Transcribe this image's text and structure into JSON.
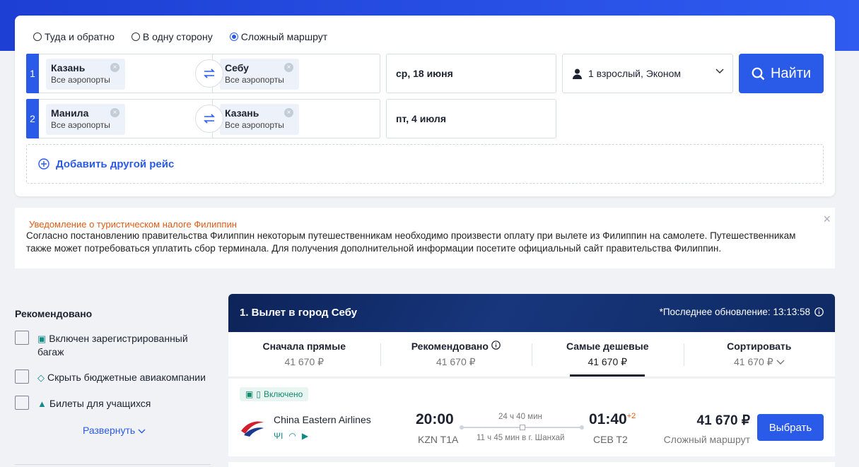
{
  "search": {
    "trip_types": [
      {
        "label": "Туда и обратно",
        "selected": false
      },
      {
        "label": "В одну сторону",
        "selected": false
      },
      {
        "label": "Сложный маршрут",
        "selected": true
      }
    ],
    "legs": [
      {
        "num": "1",
        "from": {
          "city": "Казань",
          "sub": "Все аэропорты"
        },
        "to": {
          "city": "Себу",
          "sub": "Все аэропорты"
        },
        "date": "ср, 18 июня"
      },
      {
        "num": "2",
        "from": {
          "city": "Манила",
          "sub": "Все аэропорты"
        },
        "to": {
          "city": "Казань",
          "sub": "Все аэропорты"
        },
        "date": "пт, 4 июля"
      }
    ],
    "passengers": "1 взрослый, Эконом",
    "find_label": "Найти",
    "add_leg_label": "Добавить другой рейс"
  },
  "notice": {
    "title": "Уведомление о туристическом налоге Филиппин",
    "text": "Согласно постановлению правительства Филиппин некоторым путешественникам необходимо произвести оплату при вылете из Филиппин на самолете. Путешественникам также может потребоваться уплатить сбор терминала. Для получения дополнительной информации посетите официальный сайт правительства Филиппин.",
    "close": "×"
  },
  "filters": {
    "title": "Рекомендовано",
    "items": [
      {
        "label": "Включен зарегистрированный багаж",
        "icon": "luggage-icon"
      },
      {
        "label": "Скрыть бюджетные авиакомпании",
        "icon": "tag-icon"
      },
      {
        "label": "Билеты для учащихся",
        "icon": "graduation-cap-icon"
      }
    ],
    "expand_label": "Развернуть"
  },
  "results": {
    "title": "1. Вылет в город Себу",
    "updated": "*Последнее обновление: 13:13:58",
    "sort_tabs": [
      {
        "label": "Сначала прямые",
        "price": "41 670 ₽",
        "active": false
      },
      {
        "label": "Рекомендовано",
        "price": "41 670 ₽",
        "active": false
      },
      {
        "label": "Самые дешевые",
        "price": "41 670 ₽",
        "active": true
      },
      {
        "label": "Сортировать",
        "price": "41 670 ₽",
        "active": false
      }
    ],
    "flight": {
      "badge": "Включено",
      "airline": "China Eastern Airlines",
      "dep_time": "20:00",
      "dep_airport": "KZN T1A",
      "arr_time": "01:40",
      "arr_day_offset": "+2",
      "arr_airport": "CEB T2",
      "duration": "24 ч 40 мин",
      "layover": "11 ч 45 мин в г. Шанхай",
      "price": "41 670 ₽",
      "price_sub": "Сложный маршрут",
      "select_label": "Выбрать"
    }
  },
  "colors": {
    "accent": "#2a5ae8",
    "orange": "#e05a14",
    "teal": "#138a86"
  }
}
